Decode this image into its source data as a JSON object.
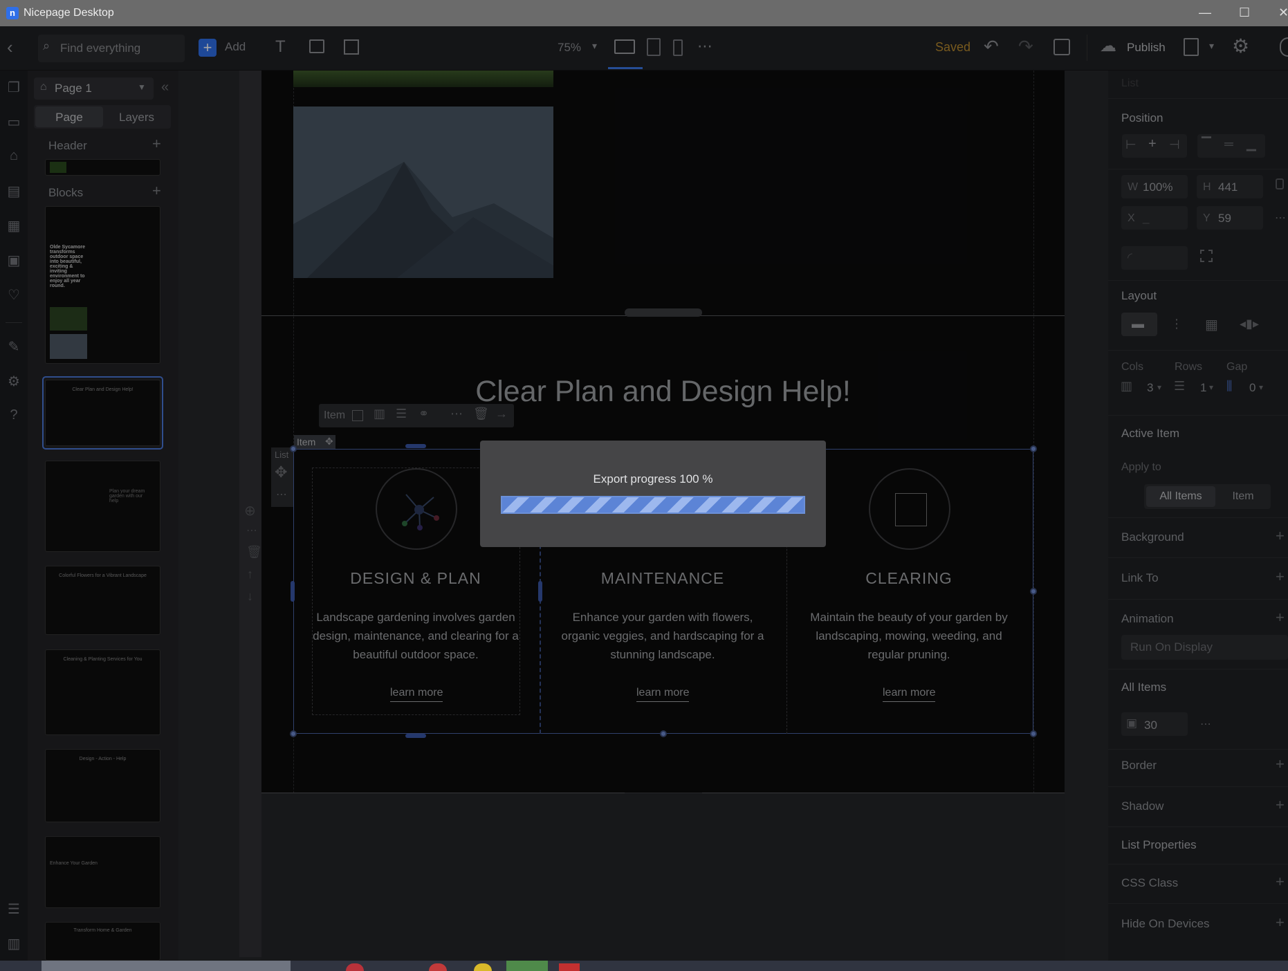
{
  "window": {
    "app_title": "Nicepage Desktop",
    "minimize": "—",
    "maximize": "☐",
    "close": "✕"
  },
  "toolbar": {
    "search_placeholder": "Find everything",
    "add_label": "Add",
    "zoom": "75%",
    "status": "Saved",
    "publish_label": "Publish"
  },
  "left_panel": {
    "page_select": "Page 1",
    "tabs": [
      "Page",
      "Layers"
    ],
    "header_label": "Header",
    "blocks_label": "Blocks",
    "thumbs": [
      {
        "title": "Olde Sycamore transforms outdoor space into beautiful, exciting & inviting environment to enjoy all year round."
      },
      {
        "title": "Clear Plan and Design Help!"
      },
      {
        "title": "Plan your dream garden with our help"
      },
      {
        "title": "Colorful Flowers for a Vibrant Landscape"
      },
      {
        "title": "Cleaning & Planting Services for You"
      },
      {
        "title": "Design - Action - Help"
      },
      {
        "title": "Enhance Your Garden"
      },
      {
        "title": "Transform Home & Garden"
      }
    ]
  },
  "canvas": {
    "section_heading": "Clear Plan and Design Help!",
    "item_toolbar_label": "Item",
    "list_tag": "List",
    "item_tag": "Item",
    "services": [
      {
        "title": "DESIGN & PLAN",
        "text": "Landscape gardening involves garden design, maintenance, and clearing for a beautiful outdoor space.",
        "link": "learn more"
      },
      {
        "title": "MAINTENANCE",
        "text": "Enhance your garden with flowers, organic veggies, and hardscaping for a stunning landscape.",
        "link": "learn more"
      },
      {
        "title": "CLEARING",
        "text": "Maintain the beauty of your garden by landscaping, mowing, weeding, and regular pruning.",
        "link": "learn more"
      }
    ]
  },
  "export_dialog": {
    "text": "Export progress 100 %",
    "progress": 1.0
  },
  "right_panel": {
    "panel_title": "List",
    "position_label": "Position",
    "w_label": "W",
    "w_value": "100%",
    "h_label": "H",
    "h_value": "441",
    "x_label": "X",
    "x_value": "_",
    "y_label": "Y",
    "y_value": "59",
    "layout_label": "Layout",
    "cols_label": "Cols",
    "cols_value": "3",
    "rows_label": "Rows",
    "rows_value": "1",
    "gap_label": "Gap",
    "gap_value": "0",
    "active_item_label": "Active Item",
    "apply_to_label": "Apply to",
    "apply_all": "All Items",
    "apply_item": "Item",
    "background_label": "Background",
    "link_to_label": "Link To",
    "animation_label": "Animation",
    "animation_value": "Run On Display",
    "all_items_label": "All Items",
    "padding_value": "30",
    "border_label": "Border",
    "shadow_label": "Shadow",
    "list_properties_label": "List Properties",
    "css_class_label": "CSS Class",
    "hide_on_devices_label": "Hide On Devices"
  }
}
